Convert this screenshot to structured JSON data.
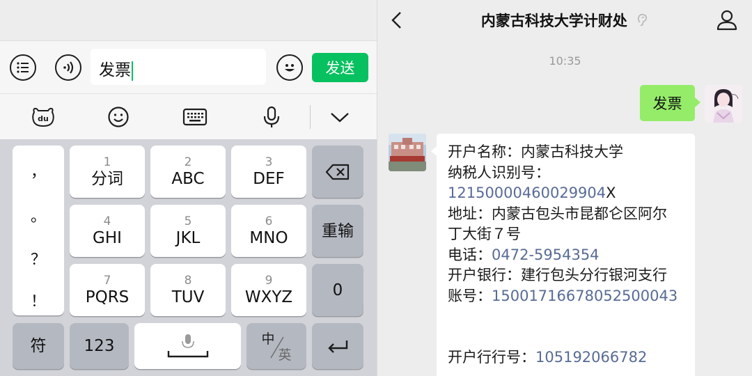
{
  "input": {
    "text": "发票",
    "send_label": "发送"
  },
  "keyboard": {
    "punctuation": [
      "，",
      "。",
      "？",
      "！"
    ],
    "keys": [
      {
        "num": "1",
        "label": "分词"
      },
      {
        "num": "2",
        "label": "ABC"
      },
      {
        "num": "3",
        "label": "DEF"
      },
      {
        "num": "4",
        "label": "GHI"
      },
      {
        "num": "5",
        "label": "JKL"
      },
      {
        "num": "6",
        "label": "MNO"
      },
      {
        "num": "7",
        "label": "PQRS"
      },
      {
        "num": "8",
        "label": "TUV"
      },
      {
        "num": "9",
        "label": "WXYZ"
      }
    ],
    "reinput_label": "重输",
    "zero_label": "0",
    "symbols_label": "符",
    "num_label": "123",
    "lang_zh": "中",
    "lang_en": "英"
  },
  "chat": {
    "title": "内蒙古科技大学计财处",
    "time": "10:35",
    "my_message": "发票",
    "reply": {
      "name_label": "开户名称：",
      "name_value": "内蒙古科技大学",
      "tax_label": "纳税人识别号：",
      "tax_digits": "1215000046002990",
      "tax_digit_last": "4",
      "tax_suffix": "X",
      "address_label": "地址：",
      "address_line1": "内蒙古包头市昆都仑区阿尔",
      "address_line2": "丁大街７号",
      "phone_label": "电话：",
      "phone_value": "0472-5954354",
      "bank_label": "开户银行：",
      "bank_value": "建行包头分行银河支行",
      "account_label": "账号：",
      "account_value": "15001716678052500043",
      "bank_no_label": "开户行行号：",
      "bank_no_value": "105192066782"
    }
  }
}
